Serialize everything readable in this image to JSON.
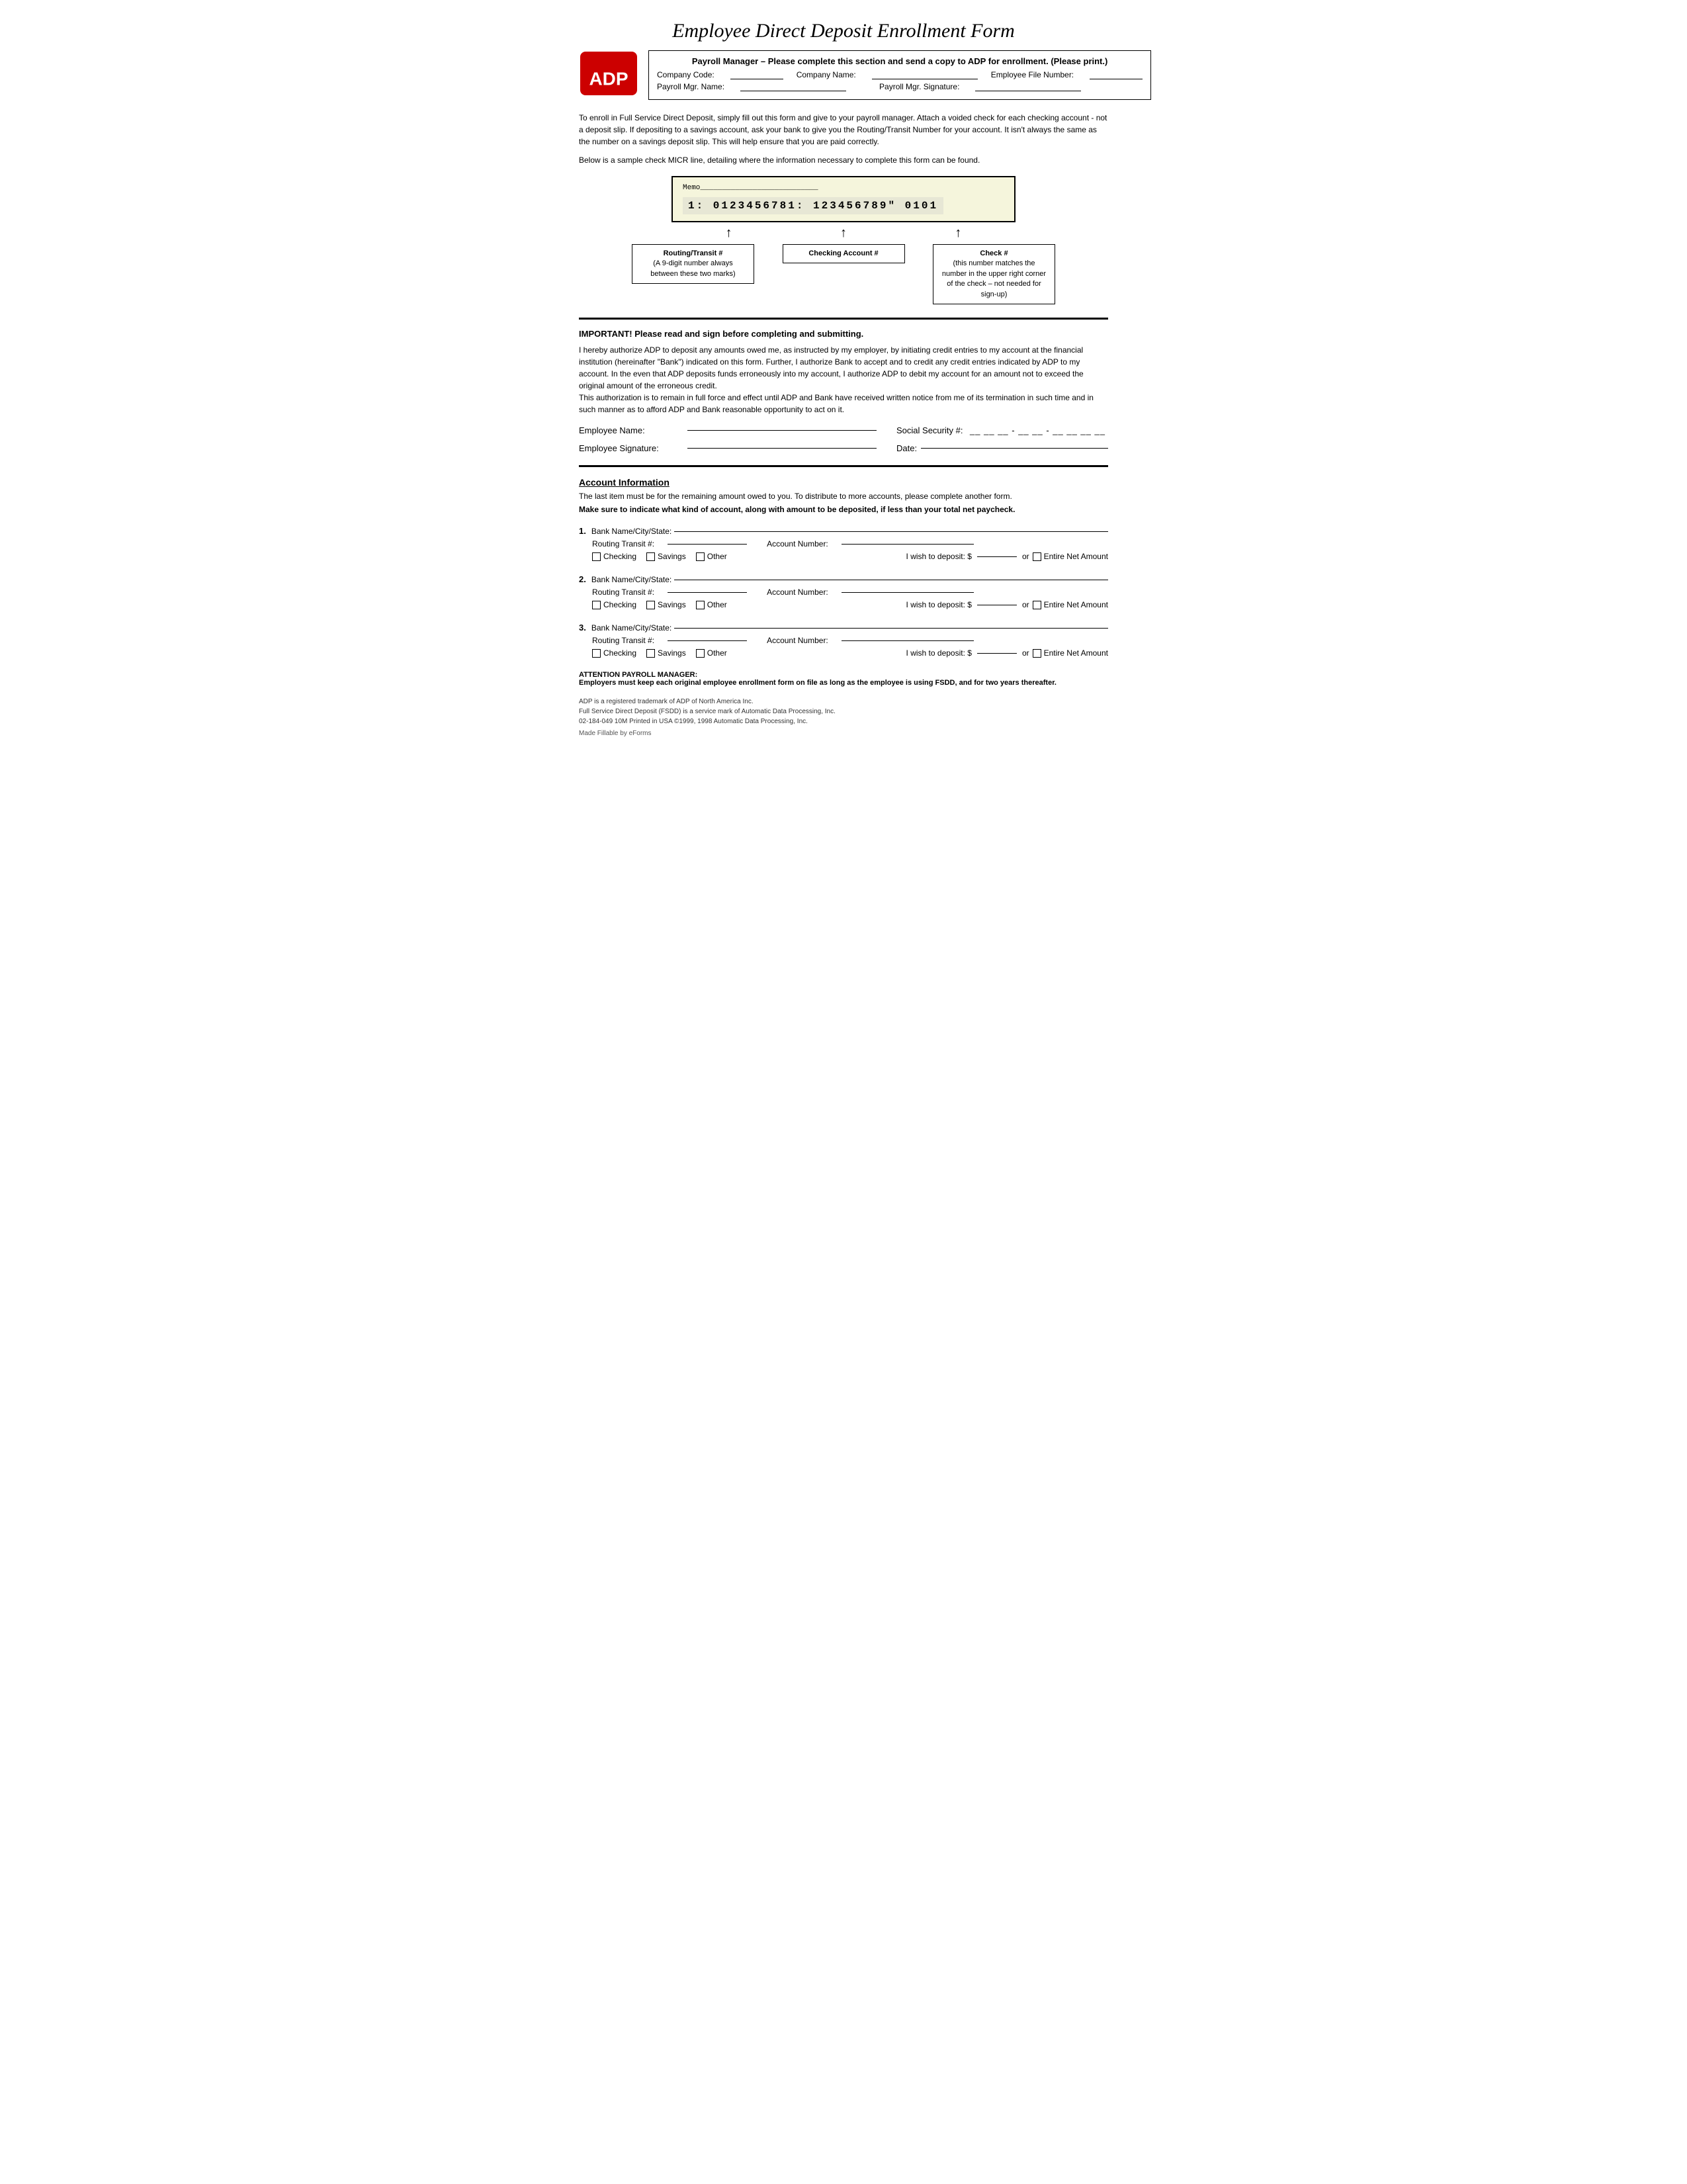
{
  "title": "Employee Direct Deposit Enrollment Form",
  "header": {
    "bold_instruction": "Payroll Manager – Please complete this section and send a copy to ADP for enrollment. (Please print.)",
    "company_code_label": "Company Code:",
    "company_name_label": "Company Name:",
    "employee_file_label": "Employee File Number:",
    "payroll_mgr_label": "Payroll Mgr. Name:",
    "payroll_sig_label": "Payroll Mgr. Signature:"
  },
  "intro": {
    "paragraph1": "To enroll in Full Service Direct Deposit, simply fill out this form and give to your payroll manager.  Attach a voided check for each checking account - not a deposit slip. If depositing to a savings account, ask your bank to give you the Routing/Transit Number for your account.  It isn't always the same as the number on a savings deposit slip. This will help ensure that you are paid correctly.",
    "paragraph2": "Below is a sample check MICR line, detailing where the information necessary to complete this form can be found."
  },
  "check_diagram": {
    "memo_label": "Memo",
    "micr_line": "1: 0123456781: 123456789\" 0101",
    "labels": {
      "routing": {
        "title": "Routing/Transit #",
        "subtitle": "(A 9-digit number always between these two marks)"
      },
      "checking": {
        "title": "Checking Account #"
      },
      "check_num": {
        "title": "Check #",
        "subtitle": "(this number matches the number in the upper right corner of the check – not needed for sign-up)"
      }
    }
  },
  "important": {
    "heading": "IMPORTANT! Please read and sign before completing and submitting.",
    "body": "I hereby authorize ADP to deposit any amounts owed me, as instructed by my employer, by initiating credit entries to my account at the financial institution (hereinafter \"Bank\") indicated on this form.  Further, I authorize Bank to accept and to credit any credit entries indicated by ADP to my account. In the even that ADP deposits funds erroneously into my account, I authorize ADP to debit my account for an amount not to exceed the original amount of the erroneous credit.\n    This authorization is to remain in full force and effect until ADP and Bank have received written notice from me of its termination in such time and in such manner as to afford ADP and Bank reasonable opportunity to act on it."
  },
  "employee_fields": {
    "name_label": "Employee Name:",
    "sig_label": "Employee Signature:",
    "date_label": "Date:",
    "ssn_label": "Social Security #:"
  },
  "account_info": {
    "heading": "Account Information",
    "sub_text": "The last item must be for the remaining amount owed to you. To distribute to more accounts, please complete another form.",
    "bold_text": "Make sure to indicate what kind of account, along with amount to be deposited, if less than your total net paycheck.",
    "accounts": [
      {
        "num": "1.",
        "bank_label": "Bank Name/City/State:",
        "routing_label": "Routing Transit #:",
        "routing_dashes": "__ __ __ __ __ __ __ __ __",
        "account_label": "Account Number:",
        "checking_label": "Checking",
        "savings_label": "Savings",
        "other_label": "Other",
        "deposit_label": "I wish to deposit: $",
        "or_label": "or",
        "entire_net_label": "Entire Net Amount"
      },
      {
        "num": "2.",
        "bank_label": "Bank Name/City/State:",
        "routing_label": "Routing Transit #:",
        "routing_dashes": "__ __ __ __ __ __ __ __ __",
        "account_label": "Account Number:",
        "checking_label": "Checking",
        "savings_label": "Savings",
        "other_label": "Other",
        "deposit_label": "I wish to deposit: $",
        "or_label": "or",
        "entire_net_label": "Entire Net Amount"
      },
      {
        "num": "3.",
        "bank_label": "Bank Name/City/State:",
        "routing_label": "Routing Transit #:",
        "routing_dashes": "__ __ __ __ __ __ __ __ __",
        "account_label": "Account Number:",
        "checking_label": "Checking",
        "savings_label": "Savings",
        "other_label": "Other",
        "deposit_label": "I wish to deposit: $",
        "or_label": "or",
        "entire_net_label": "Entire Net Amount"
      }
    ]
  },
  "attention": {
    "heading": "ATTENTION PAYROLL MANAGER:",
    "body": "Employers must keep each original employee enrollment form on file as long as the employee is using FSDD, and for two years thereafter."
  },
  "footer": {
    "line1": "ADP is a registered trademark of ADP of North America Inc.",
    "line2": "Full Service Direct Deposit (FSDD) is a service mark of Automatic Data Processing, Inc.",
    "line3": "02-184-049 10M Printed in USA ©1999, 1998 Automatic Data Processing, Inc.",
    "made_fillable": "Made Fillable by eForms"
  }
}
